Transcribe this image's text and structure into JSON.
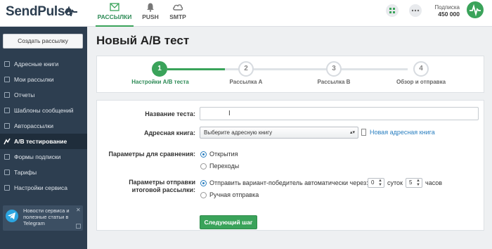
{
  "app": {
    "logo_text": "SendPulse"
  },
  "topnav": {
    "tabs": [
      {
        "label": "РАССЫЛКИ",
        "icon": "mail-icon",
        "active": true
      },
      {
        "label": "PUSH",
        "icon": "bell-icon",
        "active": false
      },
      {
        "label": "SMTP",
        "icon": "cloud-icon",
        "active": false
      }
    ],
    "subscription_label": "Подписка",
    "subscription_value": "450 000"
  },
  "sidebar": {
    "create_button": "Создать рассылку",
    "items": [
      {
        "label": "Адресные книги",
        "icon": "book-icon"
      },
      {
        "label": "Мои рассылки",
        "icon": "mail-icon"
      },
      {
        "label": "Отчеты",
        "icon": "check-icon"
      },
      {
        "label": "Шаблоны сообщений",
        "icon": "template-icon"
      },
      {
        "label": "Авторассылки",
        "icon": "auto-icon"
      },
      {
        "label": "A/B тестирование",
        "icon": "ab-icon",
        "active": true
      },
      {
        "label": "Формы подписки",
        "icon": "form-icon"
      },
      {
        "label": "Тарифы",
        "icon": "tariff-icon"
      },
      {
        "label": "Настройки сервиса",
        "icon": "settings-icon"
      }
    ],
    "telegram": {
      "text": "Новости сервиса и полезные статьи в Telegram",
      "close": "✕"
    }
  },
  "page": {
    "title": "Новый A/B тест"
  },
  "steps": [
    {
      "number": "1",
      "label": "Настройки A/B теста",
      "active": true
    },
    {
      "number": "2",
      "label": "Рассылка A",
      "active": false
    },
    {
      "number": "3",
      "label": "Рассылка B",
      "active": false
    },
    {
      "number": "4",
      "label": "Обзор и отправка",
      "active": false
    }
  ],
  "form": {
    "test_name_label": "Название теста:",
    "test_name_value": "",
    "address_book_label": "Адресная книга:",
    "address_book_selected": "Выберите адресную книгу",
    "new_address_book_link": "Новая адресная книга",
    "compare_label": "Параметры для сравнения:",
    "compare_options": [
      "Открытия",
      "Переходы"
    ],
    "send_params_label_line1": "Параметры отправки",
    "send_params_label_line2": "итоговой рассылки:",
    "auto_send_text": "Отправить вариант-победитель автоматически через:",
    "days_value": "0",
    "days_label": "суток",
    "hours_value": "5",
    "hours_label": "часов",
    "manual_send_text": "Ручная отправка",
    "next_button": "Следующий шаг"
  }
}
